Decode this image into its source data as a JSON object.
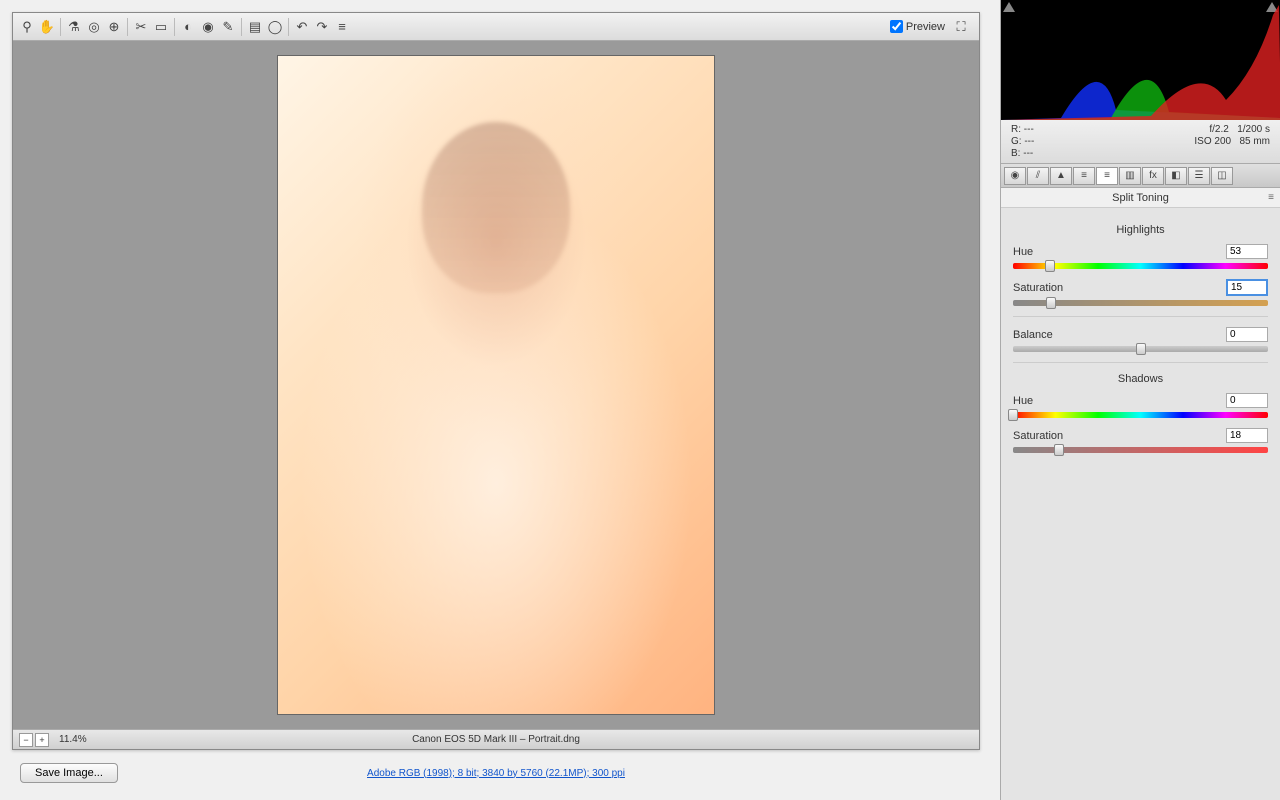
{
  "toolbar": {
    "preview_label": "Preview",
    "preview_checked": true
  },
  "status": {
    "zoom": "11.4%",
    "camera_file": "Canon EOS 5D Mark III  –  Portrait.dng"
  },
  "bottom": {
    "save_label": "Save Image...",
    "meta_link": "Adobe RGB (1998); 8 bit; 3840 by 5760 (22.1MP); 300 ppi"
  },
  "rgb": {
    "r_label": "R:",
    "r_val": "---",
    "g_label": "G:",
    "g_val": "---",
    "b_label": "B:",
    "b_val": "---",
    "aperture": "f/2.2",
    "shutter": "1/200 s",
    "iso": "ISO 200",
    "focal": "85 mm"
  },
  "panel": {
    "title": "Split Toning",
    "highlights_label": "Highlights",
    "shadows_label": "Shadows",
    "hue_label": "Hue",
    "sat_label": "Saturation",
    "balance_label": "Balance",
    "hl_hue": "53",
    "hl_sat": "15",
    "balance": "0",
    "sh_hue": "0",
    "sh_sat": "18"
  },
  "icons": {
    "zoom": "⚲",
    "hand": "✋",
    "wb": "⚗",
    "sampler": "◎",
    "target": "⊕",
    "crop": "✂",
    "straighten": "▭",
    "spot": "◐",
    "redeye": "◉",
    "brush": "✎",
    "grad": "▤",
    "radial": "◯",
    "rotate_l": "↶",
    "rotate_r": "↷",
    "prefs": "≡",
    "fullscreen": "⛶"
  }
}
